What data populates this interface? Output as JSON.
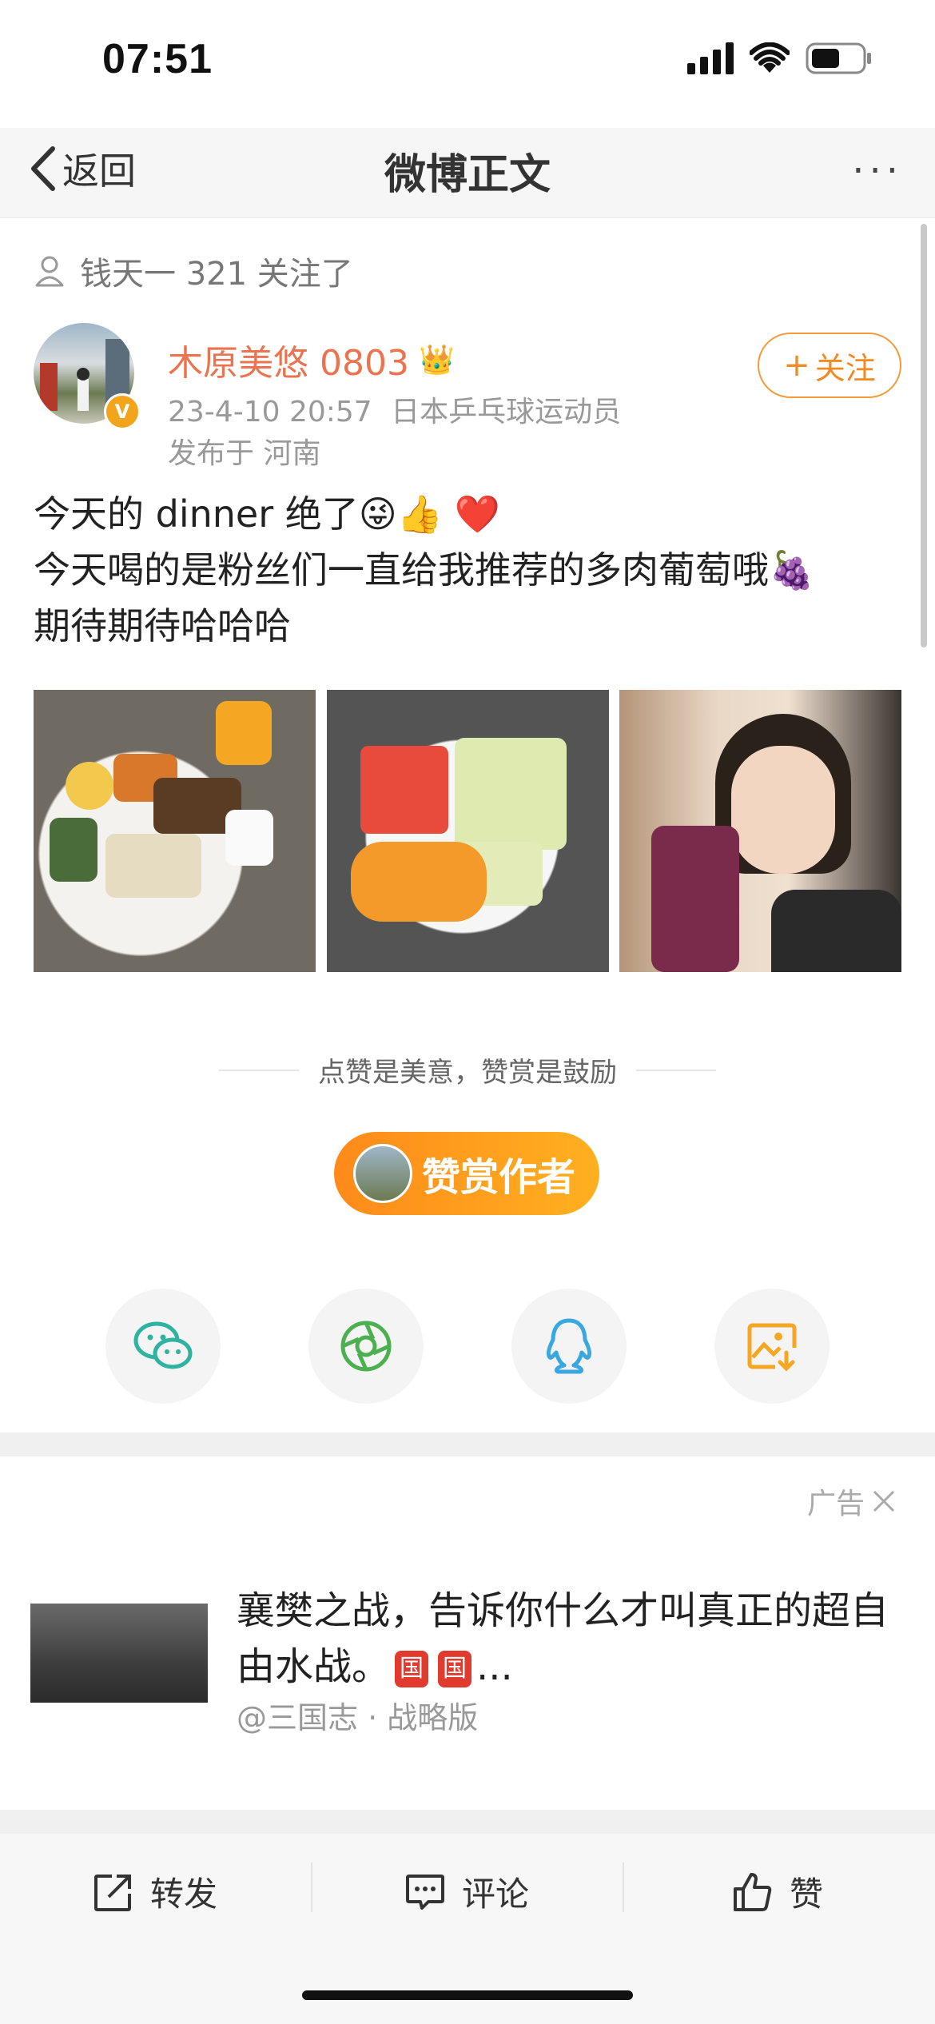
{
  "status_bar": {
    "time": "07:51"
  },
  "nav": {
    "back_label": "返回",
    "title": "微博正文",
    "more": "···"
  },
  "follow_note": "钱天一 321 关注了",
  "post": {
    "author": "木原美悠 0803",
    "avatar_badge": "V",
    "datetime": "23-4-10 20:57",
    "bio": "日本乒乓球运动员",
    "location": "发布于 河南",
    "follow_label": "关注",
    "text_lines": [
      "今天的 dinner 绝了😜👍 ❤️",
      "今天喝的是粉丝们一直给我推荐的多肉葡萄哦🍇",
      "期待期待哈哈哈"
    ]
  },
  "praise_line": "点赞是美意，赞赏是鼓励",
  "tip_button": "赞赏作者",
  "ad": {
    "label": "广告",
    "title_part1": "襄樊之战，告诉你什么才叫真正的超自由水战。",
    "bubble": "国",
    "title_end": "...",
    "source": "@三国志 · 战略版"
  },
  "bottom_bar": {
    "repost": "转发",
    "comment": "评论",
    "like": "赞"
  },
  "colors": {
    "accent_orange": "#eb7350",
    "tip_gradient": "#ff8a1a",
    "wechat": "#2fb3a0",
    "moments": "#4caf50",
    "qq": "#3aa8e0",
    "save": "#f5a623"
  }
}
